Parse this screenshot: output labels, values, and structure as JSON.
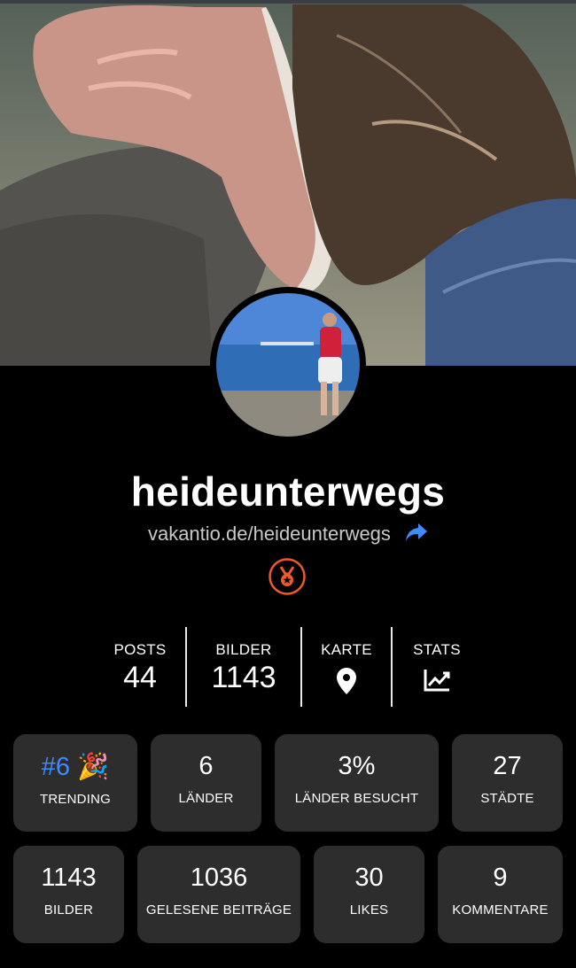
{
  "profile": {
    "username": "heideunterwegs",
    "url": "vakantio.de/heideunterwegs"
  },
  "stats": [
    {
      "label": "POSTS",
      "value": "44"
    },
    {
      "label": "BILDER",
      "value": "1143"
    },
    {
      "label": "KARTE",
      "icon": "map-pin-icon"
    },
    {
      "label": "STATS",
      "icon": "chart-line-icon"
    }
  ],
  "cards_row1": [
    {
      "rank": "#6",
      "emoji": "🎉",
      "caption": "TRENDING"
    },
    {
      "value": "6",
      "caption": "LÄNDER"
    },
    {
      "value": "3%",
      "caption": "LÄNDER BESUCHT"
    },
    {
      "value": "27",
      "caption": "STÄDTE"
    }
  ],
  "cards_row2": [
    {
      "value": "1143",
      "caption": "BILDER"
    },
    {
      "value": "1036",
      "caption": "GELESENE BEITRÄGE"
    },
    {
      "value": "30",
      "caption": "LIKES"
    },
    {
      "value": "9",
      "caption": "KOMMENTARE"
    }
  ],
  "colors": {
    "background": "#000000",
    "card": "#2d2d2d",
    "accent_blue": "#3d8bfd",
    "badge_orange": "#f05a28"
  },
  "icons": {
    "share": "share-arrow-icon",
    "badge": "medal-icon"
  }
}
